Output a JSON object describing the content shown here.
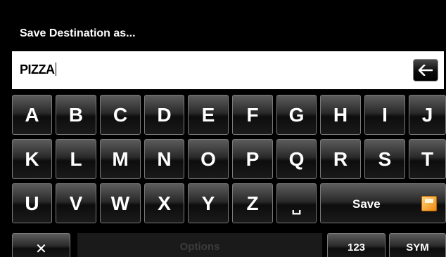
{
  "header": {
    "title": "Save Destination as..."
  },
  "input": {
    "value": "PIZZA"
  },
  "keyboard": {
    "row1": [
      "A",
      "B",
      "C",
      "D",
      "E",
      "F",
      "G",
      "H",
      "I",
      "J"
    ],
    "row2": [
      "K",
      "L",
      "M",
      "N",
      "O",
      "P",
      "Q",
      "R",
      "S",
      "T"
    ],
    "row3": [
      "U",
      "V",
      "W",
      "X",
      "Y",
      "Z"
    ],
    "space_label": "␣",
    "save_label": "Save"
  },
  "bottom_bar": {
    "close_label": "✕",
    "options_label": "Options",
    "options_enabled": false,
    "numbers_label": "123",
    "symbols_label": "SYM"
  },
  "icons": {
    "backspace": "arrow-left-icon",
    "save": "save-icon"
  },
  "colors": {
    "save_icon": "#f08a10",
    "background": "#000000"
  }
}
